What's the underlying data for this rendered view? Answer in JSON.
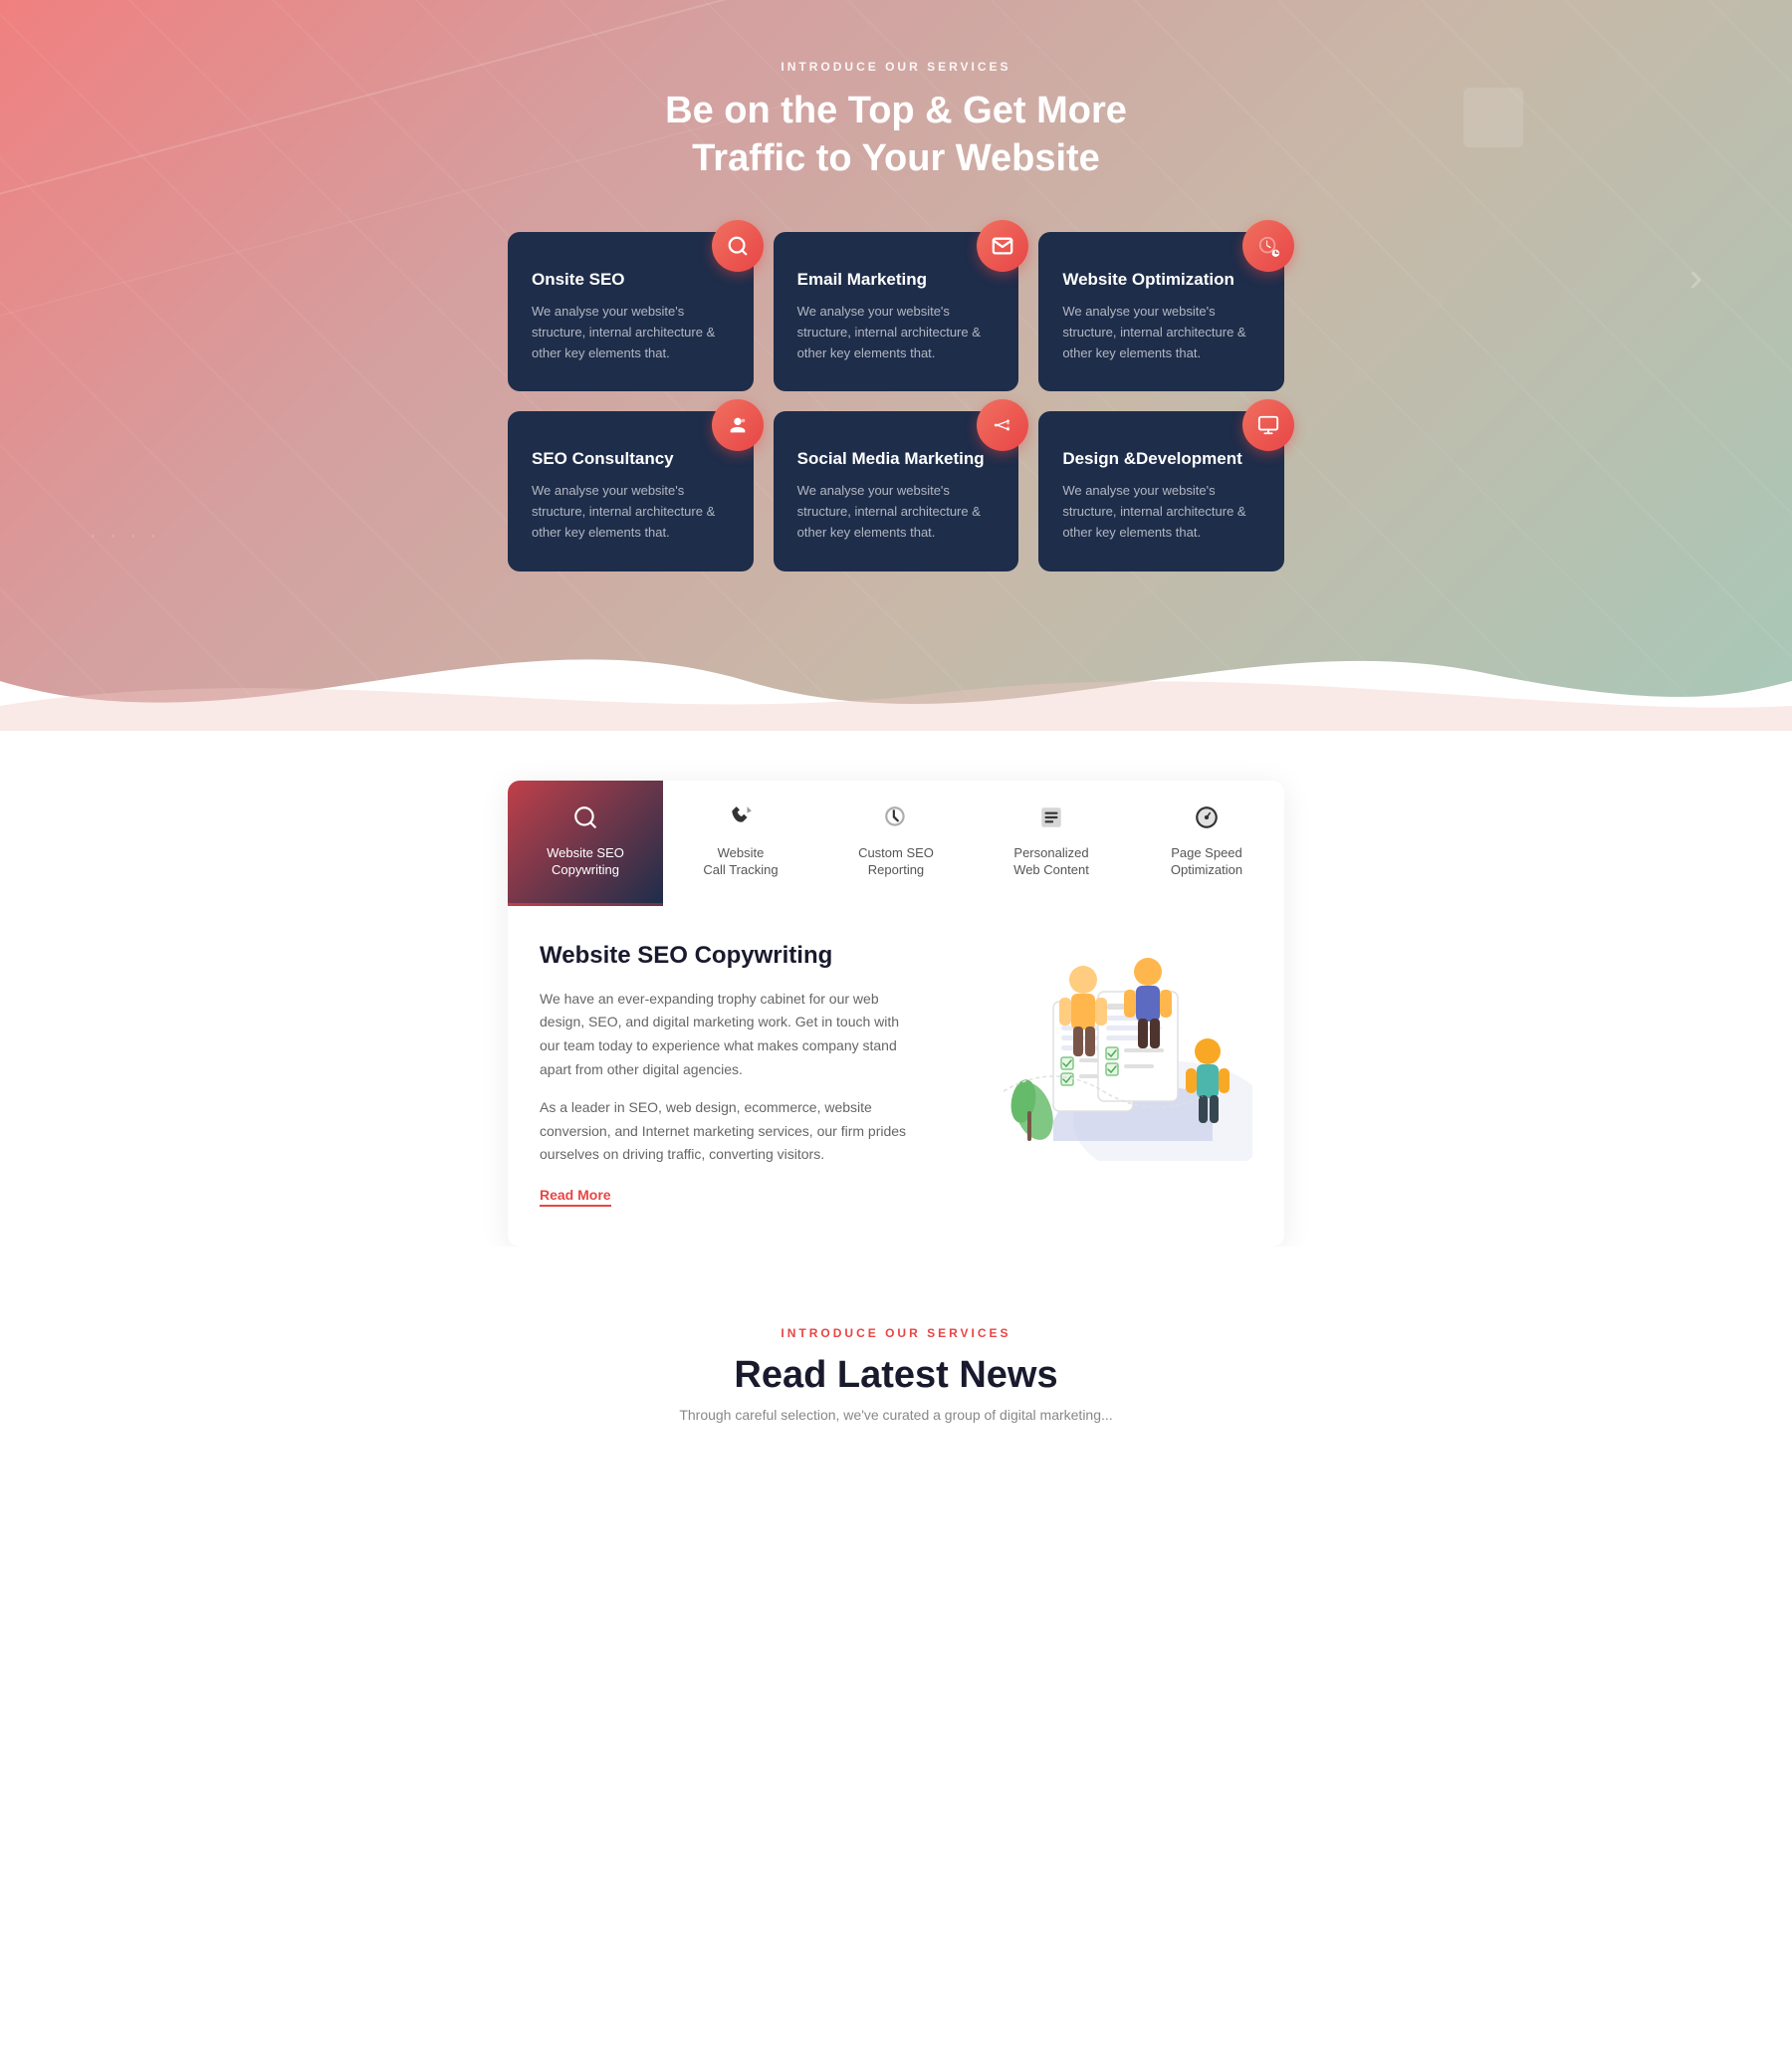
{
  "hero": {
    "section_label": "INTRODUCE OUR SERVICES",
    "title_line1": "Be on the Top & Get More",
    "title_line2": "Traffic to Your Website"
  },
  "services": [
    {
      "id": "onsite-seo",
      "title": "Onsite SEO",
      "description": "We analyse your website's structure, internal architecture & other key elements that.",
      "icon": "🔍"
    },
    {
      "id": "email-marketing",
      "title": "Email Marketing",
      "description": "We analyse your website's structure, internal architecture & other key elements that.",
      "icon": "✉"
    },
    {
      "id": "website-optimization",
      "title": "Website Optimization",
      "description": "We analyse your website's structure, internal architecture & other key elements that.",
      "icon": "📊"
    },
    {
      "id": "seo-consultancy",
      "title": "SEO Consultancy",
      "description": "We analyse your website's structure, internal architecture & other key elements that.",
      "icon": "👤"
    },
    {
      "id": "social-media-marketing",
      "title": "Social Media Marketing",
      "description": "We analyse your website's structure, internal architecture & other key elements that.",
      "icon": "📢"
    },
    {
      "id": "design-development",
      "title": "Design &Development",
      "description": "We analyse your website's structure, internal architecture & other key elements that.",
      "icon": "🖥"
    }
  ],
  "tabs": [
    {
      "id": "website-seo-copywriting",
      "label": "Website SEO\nCopywriting",
      "active": true
    },
    {
      "id": "website-call-tracking",
      "label": "Website\nCall Tracking",
      "active": false
    },
    {
      "id": "custom-seo-reporting",
      "label": "Custom SEO\nReporting",
      "active": false
    },
    {
      "id": "personalized-web-content",
      "label": "Personalized\nWeb Content",
      "active": false
    },
    {
      "id": "page-speed-optimization",
      "label": "Page Speed\nOptimization",
      "active": false
    }
  ],
  "tab_content": {
    "title": "Website SEO Copywriting",
    "paragraph1": "We have an ever-expanding trophy cabinet for our web design, SEO, and digital marketing work. Get in touch with our team today to experience what makes company stand apart from other digital agencies.",
    "paragraph2": "As a leader in SEO, web design, ecommerce, website conversion, and Internet marketing services, our firm prides ourselves on driving traffic, converting visitors.",
    "read_more_label": "Read More"
  },
  "news": {
    "section_label": "INTRODUCE OUR SERVICES",
    "title": "Read Latest News",
    "subtitle": "Through careful selection, we've curated a group of digital marketing..."
  }
}
